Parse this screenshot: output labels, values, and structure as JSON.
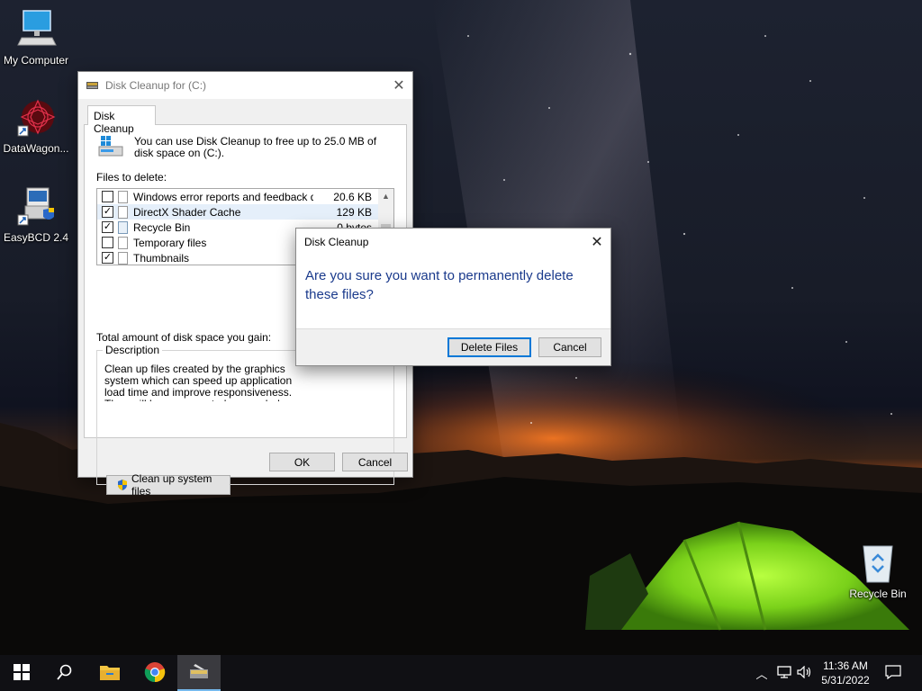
{
  "desktop": {
    "icons": [
      {
        "label": "My Computer"
      },
      {
        "label": "DataWagon..."
      },
      {
        "label": "EasyBCD 2.4"
      },
      {
        "label": "Recycle Bin"
      }
    ]
  },
  "disk_cleanup": {
    "title": "Disk Cleanup for  (C:)",
    "tab": "Disk Cleanup",
    "intro": "You can use Disk Cleanup to free up to 25.0 MB of disk space on  (C:).",
    "files_label": "Files to delete:",
    "files": [
      {
        "name": "Windows error reports and feedback di...",
        "size": "20.6 KB",
        "checked": false,
        "icon": "file-icon"
      },
      {
        "name": "DirectX Shader Cache",
        "size": "129 KB",
        "checked": true,
        "icon": "file-icon"
      },
      {
        "name": "Recycle Bin",
        "size": "0 bytes",
        "checked": true,
        "icon": "recycle-bin-icon"
      },
      {
        "name": "Temporary files",
        "size": "",
        "checked": false,
        "icon": "file-icon"
      },
      {
        "name": "Thumbnails",
        "size": "",
        "checked": true,
        "icon": "file-icon"
      }
    ],
    "total_label": "Total amount of disk space you gain:",
    "description_legend": "Description",
    "description_text": "Clean up files created by the graphics system which can speed up application load time and improve responsiveness. They will be re-generated as needed.",
    "cleanup_system_button": "Clean up system files",
    "ok_button": "OK",
    "cancel_button": "Cancel"
  },
  "confirm_dialog": {
    "title": "Disk Cleanup",
    "message": "Are you sure you want to permanently delete these files?",
    "delete_button": "Delete Files",
    "cancel_button": "Cancel"
  },
  "taskbar": {
    "time": "11:36 AM",
    "date": "5/31/2022"
  },
  "colors": {
    "accent": "#0078d7",
    "dialog_message": "#1a3a8c",
    "taskbar": "#101014"
  }
}
